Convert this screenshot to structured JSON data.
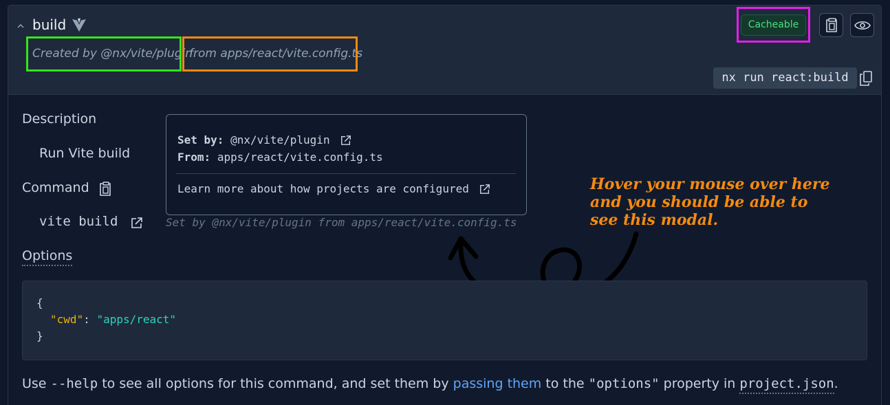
{
  "header": {
    "title": "build",
    "created_by": "Created by @nx/vite/plugin",
    "from_config": "from apps/react/vite.config.ts",
    "badge": "Cacheable",
    "command_pill": "nx run react:build"
  },
  "details": {
    "description_label": "Description",
    "description_value": "Run Vite build",
    "command_label": "Command",
    "command_value": "vite build",
    "set_by_line": "Set by @nx/vite/plugin from apps/react/vite.config.ts",
    "options_label": "Options"
  },
  "tooltip": {
    "set_by_key": "Set by:",
    "set_by_value": "@nx/vite/plugin",
    "from_key": "From:",
    "from_value": "apps/react/vite.config.ts",
    "learn_more": "Learn more about how projects are configured"
  },
  "annotation": {
    "line1": "Hover your mouse over here",
    "line2": "and you should be able to",
    "line3": "see this modal."
  },
  "options_code": {
    "open": "{",
    "key": "\"cwd\"",
    "colon": ": ",
    "value": "\"apps/react\"",
    "close": "}"
  },
  "help_text": {
    "use": "Use ",
    "flag": "--help",
    "middle": " to see all options for this command, and set them by ",
    "link": "passing them",
    "to_the": " to the ",
    "options_word": "\"options\"",
    "property_in": " property in ",
    "file": "project.json",
    "period": "."
  },
  "colors": {
    "highlight_green": "#35e31b",
    "highlight_orange": "#f58a10",
    "highlight_magenta": "#e51ee8",
    "badge_text": "#4ade80",
    "link": "#60a5fa"
  }
}
